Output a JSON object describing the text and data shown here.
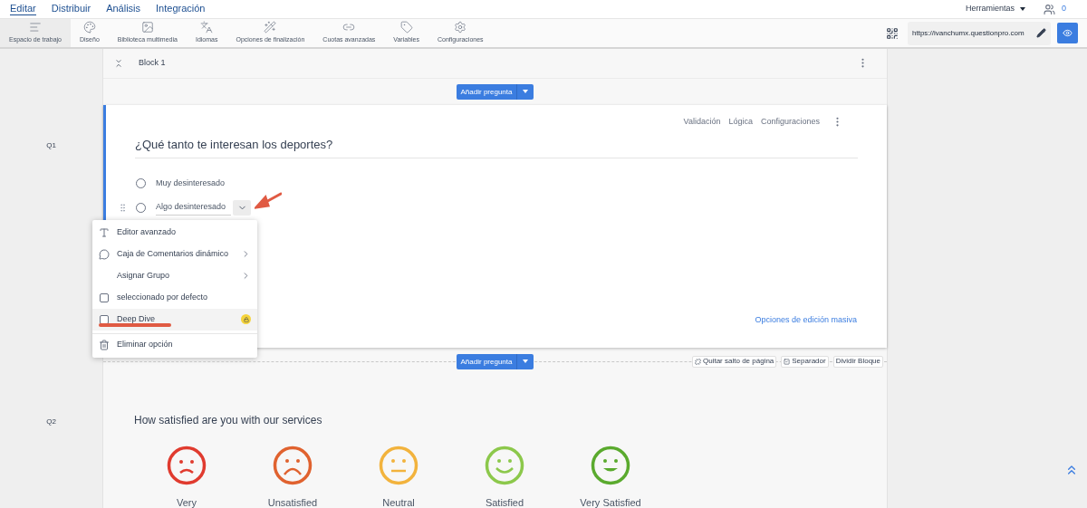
{
  "nav": {
    "tabs": [
      {
        "label": "Editar",
        "selected": true
      },
      {
        "label": "Distribuir",
        "selected": false
      },
      {
        "label": "Análisis",
        "selected": false
      },
      {
        "label": "Integración",
        "selected": false
      }
    ],
    "tools_menu": "Herramientas",
    "collaborators": "0"
  },
  "toolbar": {
    "items": [
      {
        "label": "Espacio de trabajo",
        "selected": true
      },
      {
        "label": "Diseño",
        "selected": false
      },
      {
        "label": "Biblioteca multimedia",
        "selected": false
      },
      {
        "label": "Idiomas",
        "selected": false
      },
      {
        "label": "Opciones de finalización",
        "selected": false
      },
      {
        "label": "Cuotas avanzadas",
        "selected": false
      },
      {
        "label": "Variables",
        "selected": false
      },
      {
        "label": "Configuraciones",
        "selected": false
      }
    ],
    "url": "https://ivanchumx.questionpro.com"
  },
  "block": {
    "title": "Block 1",
    "add_question": "Añadir pregunta"
  },
  "q1": {
    "number": "Q1",
    "links": [
      "Validación",
      "Lógica",
      "Configuraciones"
    ],
    "text": "¿Qué tanto te interesan los deportes?",
    "options": [
      {
        "label": "Muy desinteresado",
        "editing": false,
        "selected": false
      },
      {
        "label": "Algo desinteresado",
        "editing": true,
        "selected": false
      }
    ],
    "menu": [
      {
        "label": "Editor avanzado",
        "kind": "editor",
        "submenu": false,
        "selected": false,
        "premium": false
      },
      {
        "label": "Caja de Comentarios dinámico",
        "kind": "comment",
        "submenu": true,
        "selected": false,
        "premium": false
      },
      {
        "label": "Asignar Grupo",
        "kind": "plain",
        "submenu": true,
        "selected": false,
        "premium": false
      },
      {
        "label": "seleccionado por defecto",
        "kind": "checkbox",
        "submenu": false,
        "checked": false,
        "selected": false,
        "premium": false
      },
      {
        "label": "Deep Dive",
        "kind": "checkbox",
        "submenu": false,
        "checked": false,
        "selected": true,
        "premium": true
      },
      {
        "label": "Eliminar opción",
        "kind": "delete",
        "submenu": false,
        "selected": false,
        "premium": false
      }
    ],
    "bulk_edit": "Opciones de edición masiva"
  },
  "separator": {
    "add_question": "Añadir pregunta",
    "actions": [
      {
        "label": "Quitar salto de página",
        "kind": "unlink"
      },
      {
        "label": "Separador",
        "kind": "check"
      },
      {
        "label": "Dividir Bloque",
        "kind": "plain"
      }
    ]
  },
  "q2": {
    "number": "Q2",
    "text": "How satisfied are you with our services",
    "faces": [
      {
        "label": "Very",
        "kind": "very-sad",
        "color": "#e03b2f"
      },
      {
        "label": "Unsatisfied",
        "kind": "sad",
        "color": "#e0622f"
      },
      {
        "label": "Neutral",
        "kind": "neutral",
        "color": "#f2b33d"
      },
      {
        "label": "Satisfied",
        "kind": "happy",
        "color": "#8cc84b"
      },
      {
        "label": "Very Satisfied",
        "kind": "very-happy",
        "color": "#5aaa2e"
      }
    ]
  }
}
